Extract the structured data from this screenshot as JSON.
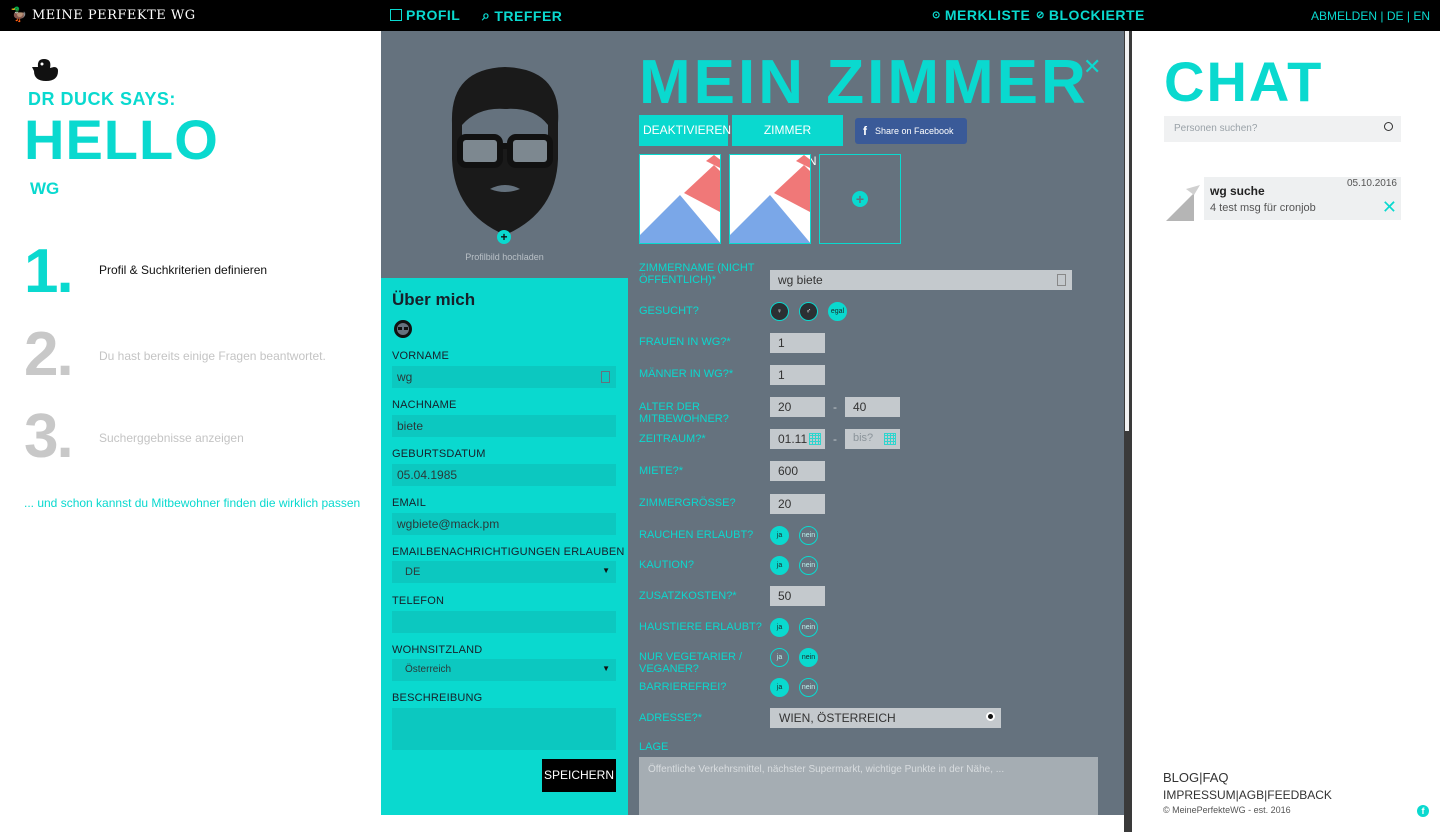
{
  "topbar": {
    "brand": "MEINE PERFEKTE WG",
    "nav_profil": "PROFIL",
    "nav_treffer": "TREFFER",
    "nav_merkliste": "MERKLISTE",
    "nav_blockierte": "BLOCKIERTE",
    "abmelden": "ABMELDEN",
    "sep": "|",
    "lang_de": "DE",
    "lang_en": "EN"
  },
  "left": {
    "says": "DR DUCK SAYS:",
    "hello": "HELLO",
    "name": "WG",
    "steps": [
      {
        "num": "1.",
        "text": "Profil & Suchkriterien definieren"
      },
      {
        "num": "2.",
        "text": "Du hast bereits einige Fragen beantwortet."
      },
      {
        "num": "3.",
        "text": "Sucherggebnisse anzeigen"
      }
    ],
    "footer": "... und schon kannst du Mitbewohner finden die wirklich passen"
  },
  "profile": {
    "avatar_label": "Profilbild hochladen",
    "heading": "Über mich",
    "fields": {
      "vorname_label": "VORNAME",
      "vorname_value": "wg",
      "nachname_label": "NACHNAME",
      "nachname_value": "biete",
      "geburtsdatum_label": "GEBURTSDATUM",
      "geburtsdatum_value": "05.04.1985",
      "email_label": "EMAIL",
      "email_value": "wgbiete@mack.pm",
      "emailbenachrichtigungen_label": "EMAILBENACHRICHTIGUNGEN ERLAUBEN",
      "emailbenachrichtigungen_value": "DE",
      "telefon_label": "TELEFON",
      "telefon_value": "",
      "wohnsitzland_label": "WOHNSITZLAND",
      "wohnsitzland_value": "Österreich",
      "beschreibung_label": "BESCHREIBUNG"
    },
    "save": "SPEICHERN"
  },
  "room": {
    "title": "MEIN ZIMMER",
    "deactivate": "DEAKTIVIEREN",
    "delete": "ZIMMER LÖSCHEN",
    "share": "Share on Facebook",
    "zimmername_label": "ZIMMERNAME (NICHT ÖFFENTLICH)*",
    "zimmername_value": "wg biete",
    "gesucht_label": "GESUCHT?",
    "gesucht_egal": "egal",
    "frauen_label": "FRAUEN IN WG?*",
    "frauen_value": "1",
    "maenner_label": "MÄNNER IN WG?*",
    "maenner_value": "1",
    "alter_label": "ALTER DER MITBEWOHNER?",
    "alter_from": "20",
    "alter_to": "40",
    "range_sep": "-",
    "zeitraum_label": "ZEITRAUM?*",
    "zeitraum_from": "01.11",
    "zeitraum_to_placeholder": "bis?",
    "miete_label": "MIETE?*",
    "miete_value": "600",
    "groesse_label": "ZIMMERGRÖSSE?",
    "groesse_value": "20",
    "rauchen_label": "RAUCHEN ERLAUBT?",
    "kaution_label": "KAUTION?",
    "zusatz_label": "ZUSATZKOSTEN?*",
    "zusatz_value": "50",
    "haustiere_label": "HAUSTIERE ERLAUBT?",
    "vegetarier_label": "NUR VEGETARIER / VEGANER?",
    "barriere_label": "BARRIEREFREI?",
    "ja": "ja",
    "nein": "nein",
    "adresse_label": "ADRESSE?*",
    "adresse_value": "WIEN, ÖSTERREICH",
    "lage_label": "LAGE",
    "lage_placeholder": "Öffentliche Verkehrsmittel, nächster Supermarkt, wichtige Punkte in der Nähe, ..."
  },
  "chat": {
    "title": "CHAT",
    "search_placeholder": "Personen suchen?",
    "item_name": "wg suche",
    "item_date": "05.10.2016",
    "item_msg": "4 test msg für cronjob",
    "footer_line1": "BLOG|FAQ",
    "footer_line2": "IMPRESSUM|AGB|FEEDBACK",
    "footer_line3": "© MeinePerfekteWG - est. 2016"
  },
  "colors": {
    "accent": "#0ad9cf",
    "room_bg": "#65727e",
    "topbar": "#000000"
  }
}
